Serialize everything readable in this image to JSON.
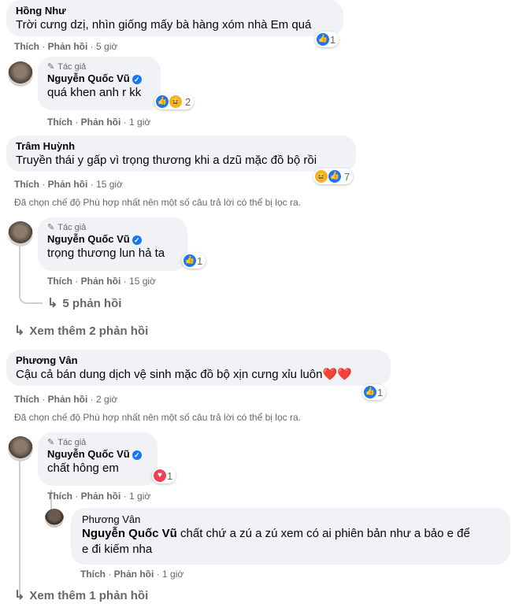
{
  "actions": {
    "like": "Thích",
    "reply": "Phản hồi"
  },
  "author_tag": "Tác giả",
  "filter_notice": "Đã chọn chế độ Phù hợp nhất nên một số câu trả lời có thể bị lọc ra.",
  "comments": [
    {
      "name": "Hồng Như",
      "text": "Trời cưng dzị, nhìn giống mấy bà hàng xóm nhà Em quá",
      "time": "5 giờ",
      "reaction_count": "1"
    },
    {
      "name": "Nguyễn Quốc Vũ",
      "text": "quá khen anh r kk",
      "time": "1 giờ",
      "reaction_count": "2"
    },
    {
      "name": "Trâm Huỳnh",
      "text": "Truyền thái y gấp vì trọng thương khi a dzũ mặc đồ bộ rồi",
      "time": "15 giờ",
      "reaction_count": "7"
    },
    {
      "name": "Nguyễn Quốc Vũ",
      "text": "trọng thương lun hả ta",
      "time": "15 giờ",
      "reaction_count": "1"
    },
    {
      "name": "Phương Vân",
      "text": "Cậu cả bán dung dịch vệ sinh mặc đồ bộ xịn cưng xỉu luôn❤️❤️",
      "time": "2 giờ",
      "reaction_count": "1"
    },
    {
      "name": "Nguyễn Quốc Vũ",
      "text": "chất hông em",
      "time": "1 giờ",
      "reaction_count": "1"
    },
    {
      "name": "Phương Vân",
      "mention": "Nguyễn Quốc Vũ",
      "text": " chất chứ a zú a zú xem có ai phiên bản như a bảo e để",
      "text2": "e đi kiếm nha",
      "time": "1 giờ"
    }
  ],
  "replies_link": "5 phản hồi",
  "view_more_1": "Xem thêm 2 phản hồi",
  "view_more_2": "Xem thêm 1 phản hồi"
}
